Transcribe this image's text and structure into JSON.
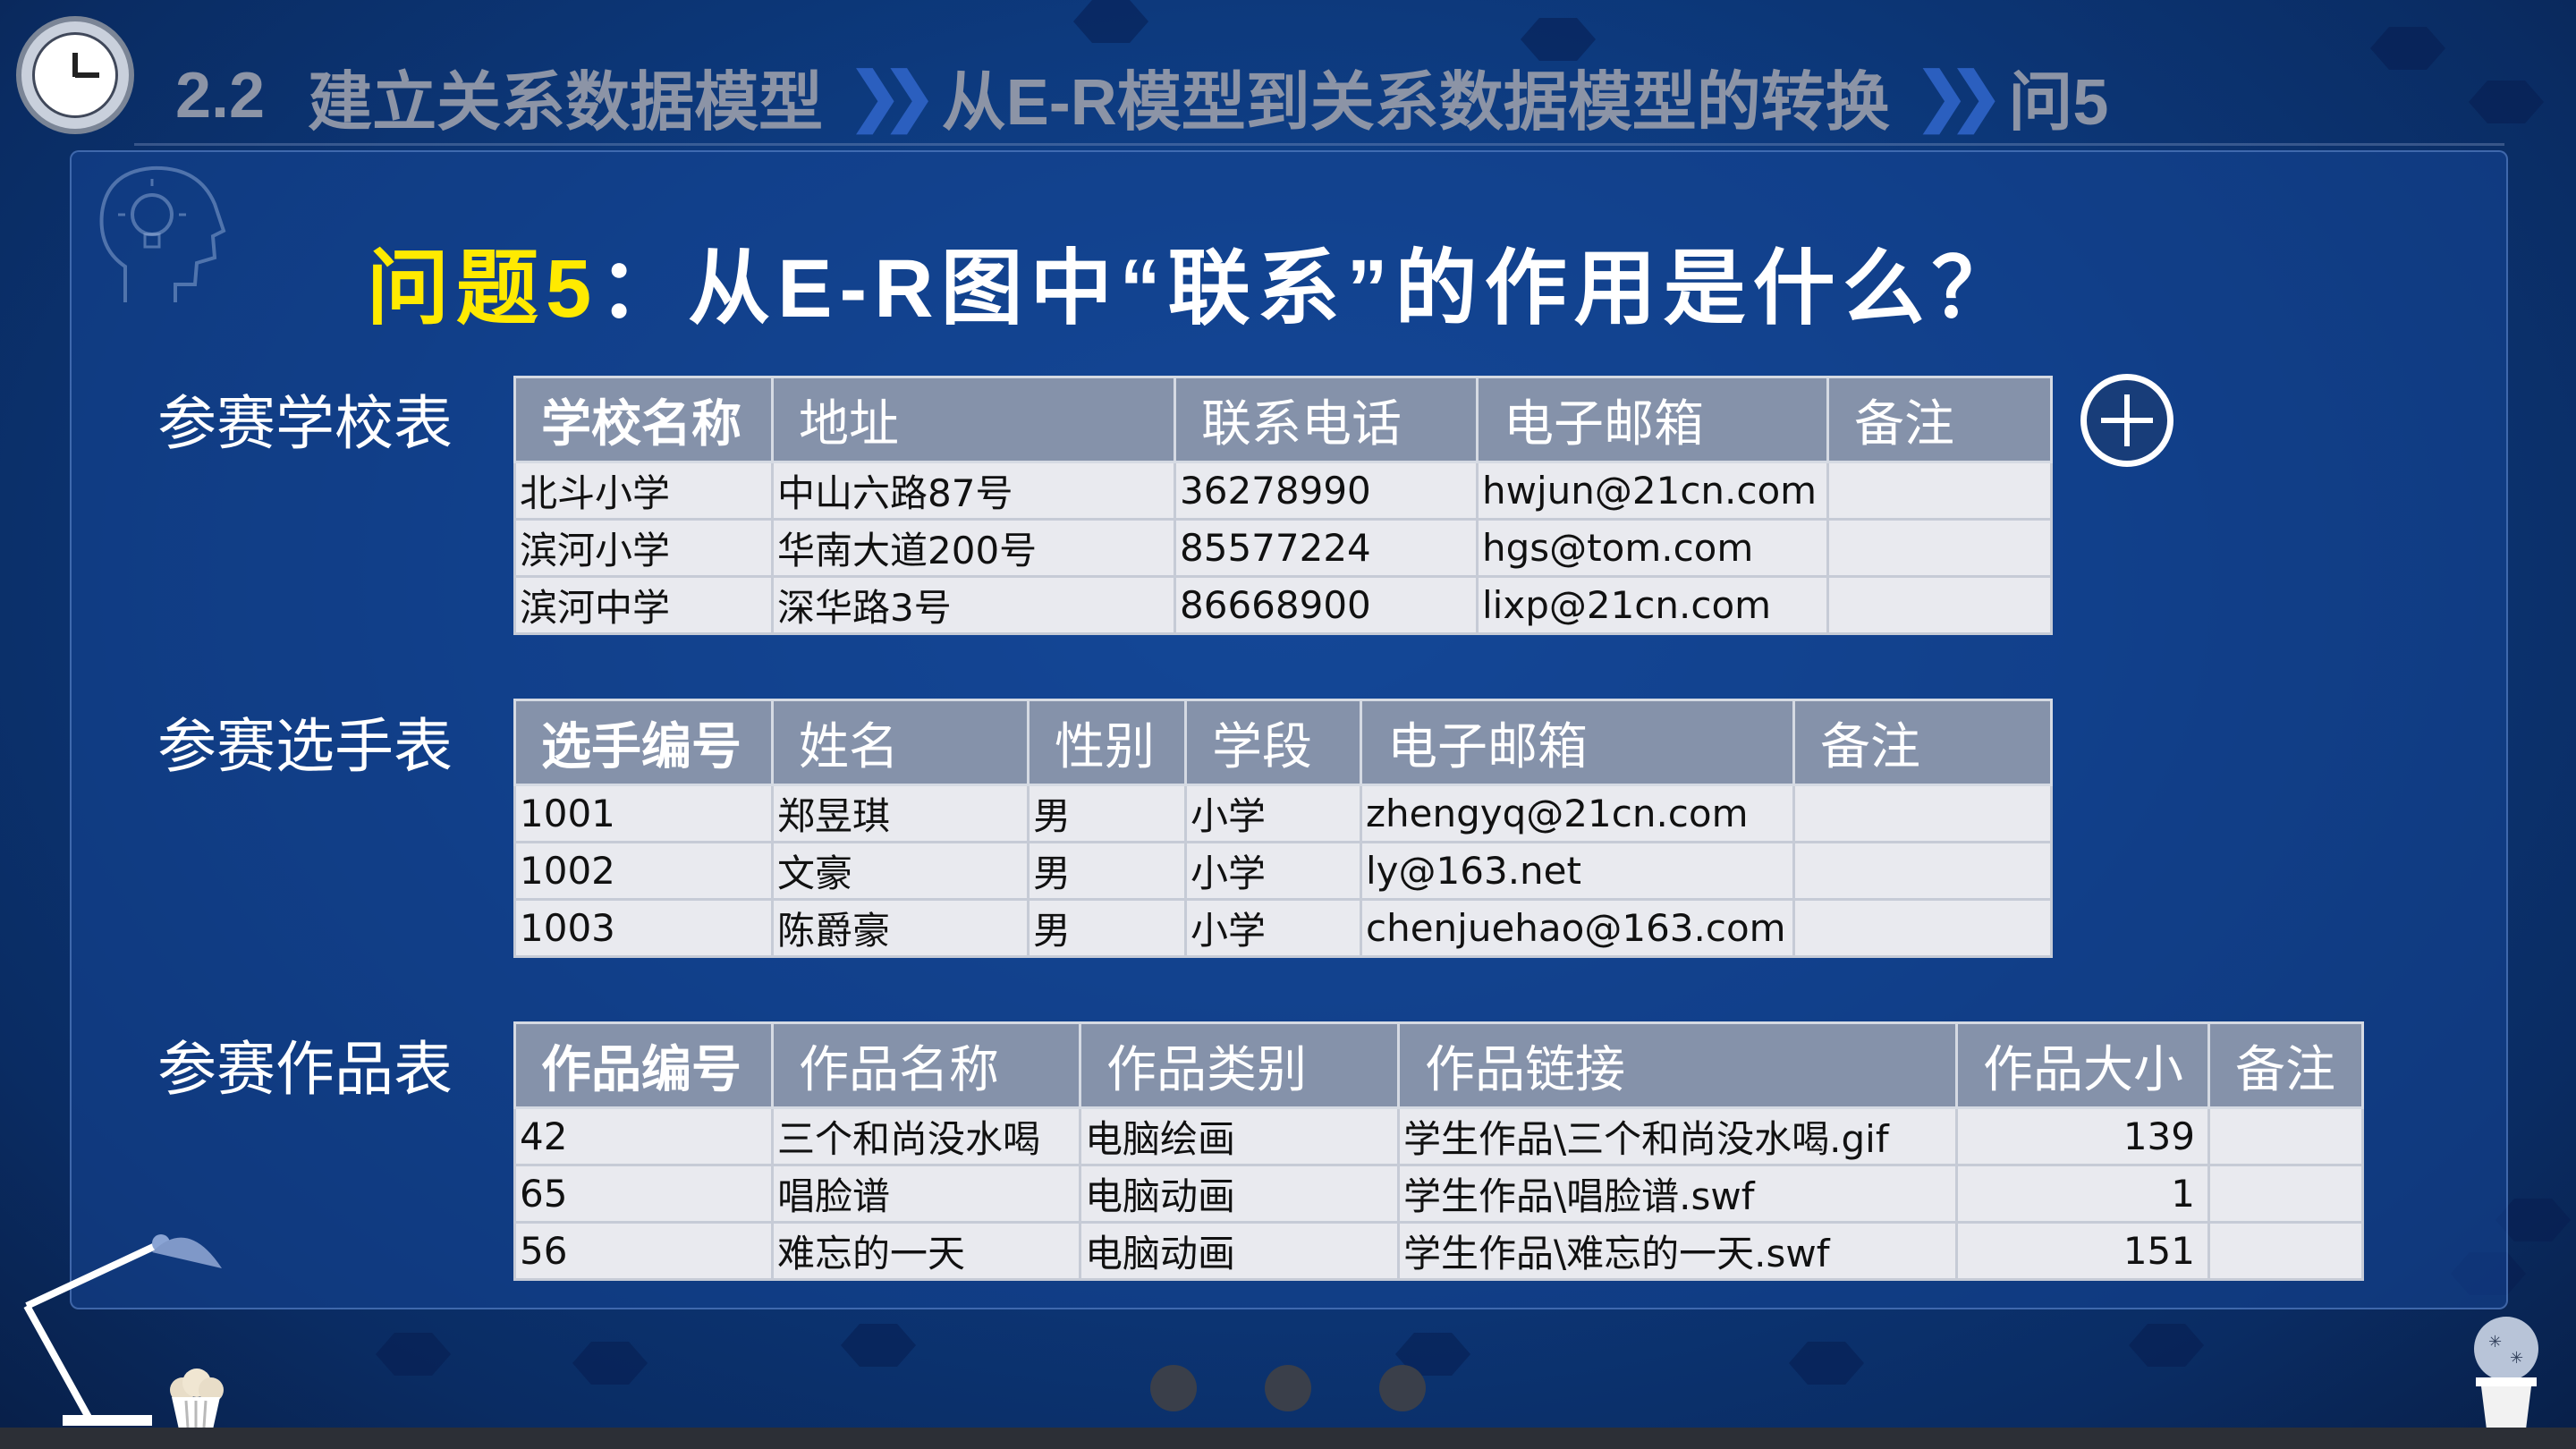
{
  "header": {
    "section": "2.2",
    "part1": "建立关系数据模型",
    "part2": "从E-R模型到关系数据模型的转换",
    "part3": "问5",
    "separator": "❯❯"
  },
  "question": {
    "highlight": "问题5",
    "text": "：从E-R图中“联系”的作用是什么？"
  },
  "tables": {
    "schools": {
      "label": "参赛学校表",
      "headers": [
        "学校名称",
        "地址",
        "联系电话",
        "电子邮箱",
        "备注"
      ],
      "rows": [
        [
          "北斗小学",
          "中山六路87号",
          "36278990",
          "hwjun@21cn.com",
          ""
        ],
        [
          "滨河小学",
          "华南大道200号",
          "85577224",
          "hgs@tom.com",
          ""
        ],
        [
          "滨河中学",
          "深华路3号",
          "86668900",
          "lixp@21cn.com",
          ""
        ]
      ]
    },
    "players": {
      "label": "参赛选手表",
      "headers": [
        "选手编号",
        "姓名",
        "性别",
        "学段",
        "电子邮箱",
        "备注"
      ],
      "rows": [
        [
          "1001",
          "郑昱琪",
          "男",
          "小学",
          "zhengyq@21cn.com",
          ""
        ],
        [
          "1002",
          "文豪",
          "男",
          "小学",
          "ly@163.net",
          ""
        ],
        [
          "1003",
          "陈爵豪",
          "男",
          "小学",
          "chenjuehao@163.com",
          ""
        ]
      ]
    },
    "works": {
      "label": "参赛作品表",
      "headers": [
        "作品编号",
        "作品名称",
        "作品类别",
        "作品链接",
        "作品大小",
        "备注"
      ],
      "rows": [
        [
          "42",
          "三个和尚没水喝",
          "电脑绘画",
          "学生作品\\三个和尚没水喝.gif",
          "139",
          ""
        ],
        [
          "65",
          "唱脸谱",
          "电脑动画",
          "学生作品\\唱脸谱.swf",
          "1",
          ""
        ],
        [
          "56",
          "难忘的一天",
          "电脑动画",
          "学生作品\\难忘的一天.swf",
          "151",
          ""
        ]
      ]
    }
  },
  "icons": {
    "clock": "clock-icon",
    "head": "lightbulb-head-icon",
    "plus": "plus-circle-icon",
    "lamp": "desk-lamp-icon",
    "cupcake": "cupcake-icon",
    "cactus": "cactus-icon"
  },
  "colors": {
    "background": "#0d3a7e",
    "highlight": "#ffea00",
    "table_header": "#8592aa",
    "table_cell": "#e9eaef"
  }
}
